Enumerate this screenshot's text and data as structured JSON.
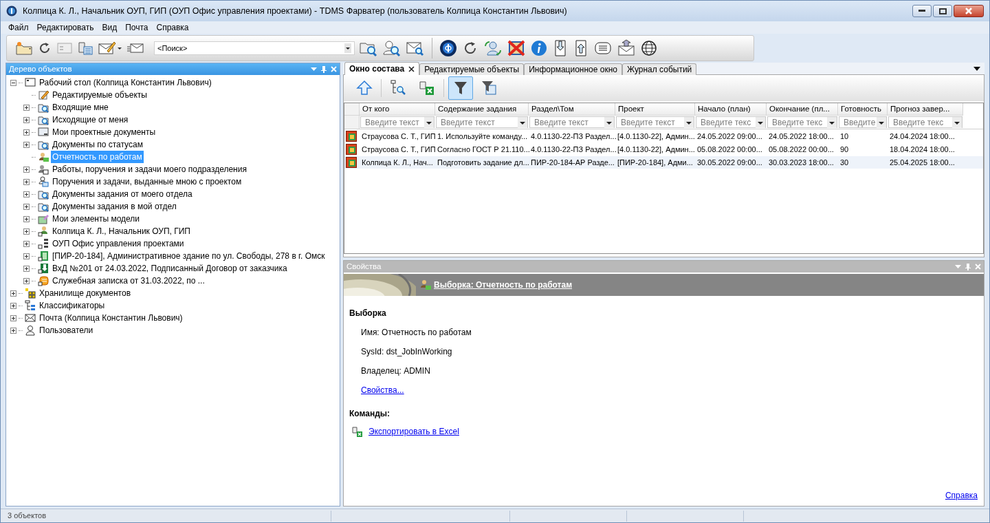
{
  "window": {
    "title": "Колпица К. Л., Начальник ОУП, ГИП (ОУП Офис управления проектами) - TDMS Фарватер (пользователь Колпица Константин Львович)"
  },
  "menu": [
    "Файл",
    "Редактировать",
    "Вид",
    "Почта",
    "Справка"
  ],
  "search": {
    "value": "<Поиск>"
  },
  "tree_panel": {
    "title": "Дерево объектов",
    "items": [
      {
        "label": "Рабочий стол (Колпица Константин Львович)",
        "expandable": true,
        "expanded": true,
        "selected": false,
        "children": [
          {
            "label": "Редактируемые объекты",
            "expandable": false,
            "selected": false
          },
          {
            "label": "Входящие мне",
            "expandable": true,
            "expanded": false,
            "selected": false
          },
          {
            "label": "Исходящие от меня",
            "expandable": true,
            "expanded": false,
            "selected": false
          },
          {
            "label": "Мои проектные документы",
            "expandable": true,
            "expanded": false,
            "selected": false
          },
          {
            "label": "Документы по статусам",
            "expandable": true,
            "expanded": false,
            "selected": false
          },
          {
            "label": "Отчетность по работам",
            "expandable": false,
            "selected": true
          },
          {
            "label": "Работы, поручения и задачи моего подразделения",
            "expandable": true,
            "expanded": false,
            "selected": false
          },
          {
            "label": "Поручения и задачи, выданные мною с проектом",
            "expandable": true,
            "expanded": false,
            "selected": false
          },
          {
            "label": "Документы задания от моего отдела",
            "expandable": true,
            "expanded": false,
            "selected": false
          },
          {
            "label": "Документы задания в мой отдел",
            "expandable": true,
            "expanded": false,
            "selected": false
          },
          {
            "label": "Мои элементы модели",
            "expandable": true,
            "expanded": false,
            "selected": false
          },
          {
            "label": "Колпица К. Л., Начальник ОУП, ГИП",
            "expandable": true,
            "expanded": false,
            "selected": false
          },
          {
            "label": "ОУП Офис управления проектами",
            "expandable": true,
            "expanded": false,
            "selected": false
          },
          {
            "label": "[ПИР-20-184], Административное здание по ул. Свободы, 278 в г. Омск",
            "expandable": true,
            "expanded": false,
            "selected": false
          },
          {
            "label": "ВхД №201 от 24.03.2022, Подписанный Договор от заказчика",
            "expandable": true,
            "expanded": false,
            "selected": false
          },
          {
            "label": "Служебная записка от 31.03.2022, по ...",
            "expandable": true,
            "expanded": false,
            "selected": false
          }
        ]
      },
      {
        "label": "Хранилище документов",
        "expandable": true,
        "expanded": false,
        "selected": false
      },
      {
        "label": "Классификаторы",
        "expandable": true,
        "expanded": false,
        "selected": false
      },
      {
        "label": "Почта (Колпица Константин Львович)",
        "expandable": true,
        "expanded": false,
        "selected": false
      },
      {
        "label": "Пользователи",
        "expandable": true,
        "expanded": false,
        "selected": false
      }
    ]
  },
  "tabs": [
    {
      "label": "Окно состава",
      "selected": true
    },
    {
      "label": "Редактируемые объекты",
      "selected": false
    },
    {
      "label": "Информационное окно",
      "selected": false
    },
    {
      "label": "Журнал событий",
      "selected": false
    }
  ],
  "content_toolbar": [
    {
      "pressed": false
    },
    {
      "pressed": false
    },
    {
      "pressed": false
    },
    {
      "pressed": true
    },
    {
      "pressed": false
    }
  ],
  "table": {
    "columns": [
      {
        "title": "От кого",
        "filter": "Введите текст"
      },
      {
        "title": "Содержание задания",
        "filter": "Введите текст"
      },
      {
        "title": "Раздел\\Том",
        "filter": "Введите текст"
      },
      {
        "title": "Проект",
        "filter": "Введите текст"
      },
      {
        "title": "Начало (план)",
        "filter": "Введите текс"
      },
      {
        "title": "Окончание (пл...",
        "filter": "Введите текс"
      },
      {
        "title": "Готовность",
        "filter": "Введите"
      },
      {
        "title": "Прогноз завер...",
        "filter": "Введите текс"
      }
    ],
    "rows": [
      {
        "selected": false,
        "cells": [
          "Страусова С. Т., ГИП",
          "1. Используйте команду...",
          "4.0.1130-22-ПЗ Раздел...",
          "[4.0.1130-22], Админ...",
          "24.05.2022 09:00...",
          "24.05.2022 18:00...",
          "10",
          "24.04.2024 18:00..."
        ]
      },
      {
        "selected": false,
        "cells": [
          "Страусова С. Т., ГИП",
          "Согласно ГОСТ Р 21.110...",
          "4.0.1130-22-ПЗ Раздел...",
          "[4.0.1130-22], Админ...",
          "05.08.2022 00:00...",
          "05.08.2022 00:00...",
          "90",
          "18.04.2024 18:00..."
        ]
      },
      {
        "selected": true,
        "cells": [
          "Колпица К. Л., Нач...",
          "Подготовить задание дл...",
          "ПИР-20-184-АР Разде...",
          "[ПИР-20-184], Адми...",
          "30.05.2022 09:00...",
          "30.03.2023 18:00...",
          "30",
          "25.04.2025 18:00..."
        ]
      }
    ]
  },
  "properties": {
    "title": "Свойства",
    "banner_link": "Выборка: Отчетность по работам",
    "section": "Выборка",
    "fields": [
      "Имя: Отчетность по работам",
      "SysId: dst_JobInWorking",
      "Владелец: ADMIN"
    ],
    "link": "Свойства...",
    "commands_title": "Команды:",
    "commands": [
      "Экспортировать в Excel"
    ],
    "help_link": "Справка"
  },
  "status_bar": [
    "3 объектов"
  ]
}
